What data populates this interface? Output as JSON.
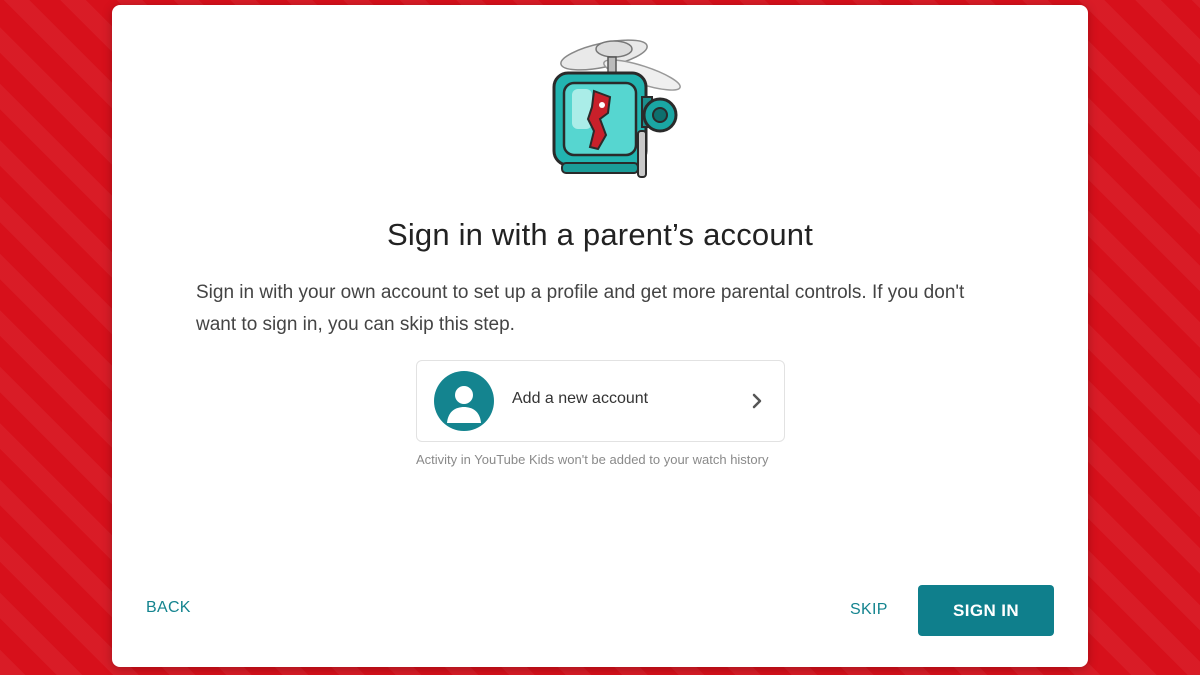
{
  "dialog": {
    "title": "Sign in with a parent’s account",
    "description": "Sign in with your own account to set up a profile and get more parental controls. If you don't want to sign in, you can skip this step.",
    "account_option": {
      "label": "Add a new account",
      "icon": "person-avatar-icon",
      "chevron_icon": "chevron-right-icon"
    },
    "note": "Activity in YouTube Kids won't be added to your watch history",
    "illustration_icon": "robot-helicopter-icon"
  },
  "actions": {
    "back_label": "BACK",
    "skip_label": "SKIP",
    "signin_label": "SIGN IN"
  },
  "colors": {
    "background": "#d7101b",
    "accent": "#14848f",
    "button": "#0f7f8c"
  }
}
